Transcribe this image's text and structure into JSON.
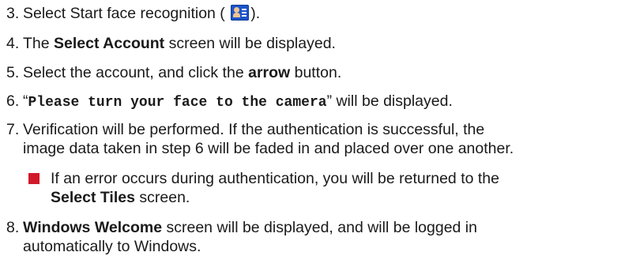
{
  "steps": [
    {
      "num": "3.",
      "pre": "Select Start face recognition (",
      "post": ")."
    },
    {
      "num": "4.",
      "pre": "The ",
      "bold": "Select Account",
      "post": " screen will be displayed."
    },
    {
      "num": "5.",
      "pre": "Select the account, and click the ",
      "bold": "arrow",
      "post": " button."
    },
    {
      "num": "6.",
      "open_quote": "“",
      "mono": "Please turn your face to the camera",
      "close": "” will be displayed."
    },
    {
      "num": "7.",
      "line1": "Verification will be performed. If the authentication is successful, the",
      "line2": "image data taken in step 6 will be faded in and placed over one another."
    },
    {
      "num": "8.",
      "bold": "Windows Welcome",
      "post": " screen will be displayed, and will be logged in",
      "line2": "automatically to Windows."
    }
  ],
  "note": {
    "line1": "If an error occurs during authentication, you will be returned to the",
    "bold": "Select Tiles",
    "post": " screen."
  },
  "icons": {
    "face_recognition": "face-recognition-icon"
  },
  "colors": {
    "bullet": "#d11a2a",
    "icon_bg": "#1b55c8"
  }
}
